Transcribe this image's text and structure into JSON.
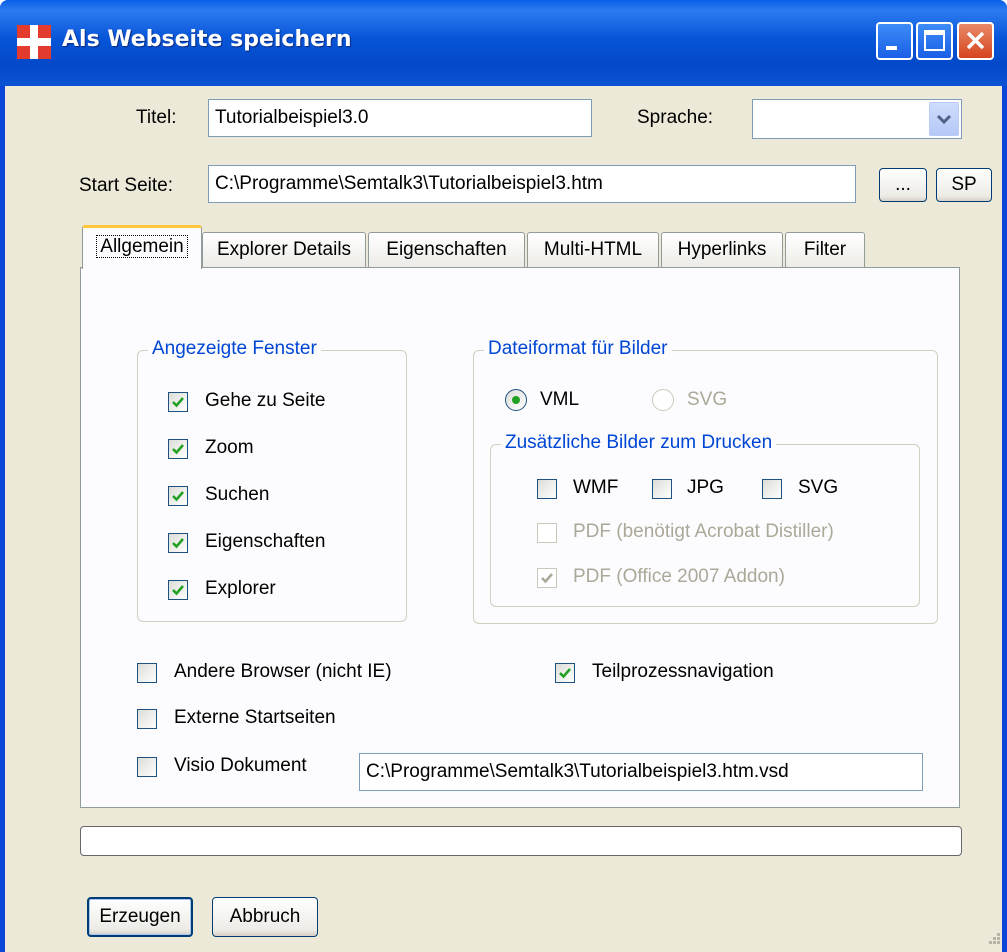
{
  "window": {
    "title": "Als Webseite speichern",
    "controls": [
      "minimize-icon",
      "maximize-icon",
      "close-icon"
    ]
  },
  "form": {
    "titel_label": "Titel:",
    "titel_value": "Tutorialbeispiel3.0",
    "sprache_label": "Sprache:",
    "sprache_value": "",
    "start_label": "Start Seite:",
    "start_value": "C:\\Programme\\Semtalk3\\Tutorialbeispiel3.htm",
    "browse_button": "...",
    "sp_button": "SP"
  },
  "tabs": [
    {
      "label": "Allgemein",
      "active": true
    },
    {
      "label": "Explorer Details",
      "active": false
    },
    {
      "label": "Eigenschaften",
      "active": false
    },
    {
      "label": "Multi-HTML",
      "active": false
    },
    {
      "label": "Hyperlinks",
      "active": false
    },
    {
      "label": "Filter",
      "active": false
    }
  ],
  "fenster": {
    "title": "Angezeigte Fenster",
    "items": [
      {
        "label": "Gehe zu Seite",
        "checked": true
      },
      {
        "label": "Zoom",
        "checked": true
      },
      {
        "label": "Suchen",
        "checked": true
      },
      {
        "label": "Eigenschaften",
        "checked": true
      },
      {
        "label": "Explorer",
        "checked": true
      }
    ]
  },
  "dateiformat": {
    "title": "Dateiformat für Bilder",
    "vml_label": "VML",
    "vml_selected": true,
    "svg_label": "SVG",
    "svg_enabled": false
  },
  "drucken": {
    "title": "Zusätzliche Bilder zum Drucken",
    "wmf_label": "WMF",
    "jpg_label": "JPG",
    "svg_label": "SVG",
    "pdf_acrobat_label": "PDF (benötigt Acrobat Distiller)",
    "pdf_office_label": "PDF (Office 2007 Addon)",
    "pdf_office_checked": true
  },
  "options": {
    "andere_browser": "Andere Browser (nicht IE)",
    "teilprozess": "Teilprozessnavigation",
    "teilprozess_checked": true,
    "externe_startseiten": "Externe Startseiten",
    "visio_dokument": "Visio Dokument",
    "visio_path": "C:\\Programme\\Semtalk3\\Tutorialbeispiel3.htm.vsd"
  },
  "progress_percent": 0,
  "buttons": {
    "erzeugen": "Erzeugen",
    "abbruch": "Abbruch"
  },
  "colors": {
    "titlebar": "#0755d8",
    "dialog_bg": "#ece9d8",
    "groupbox_title": "#0046d5",
    "check_green": "#21a121",
    "active_tab_accent": "#ffc83c"
  }
}
